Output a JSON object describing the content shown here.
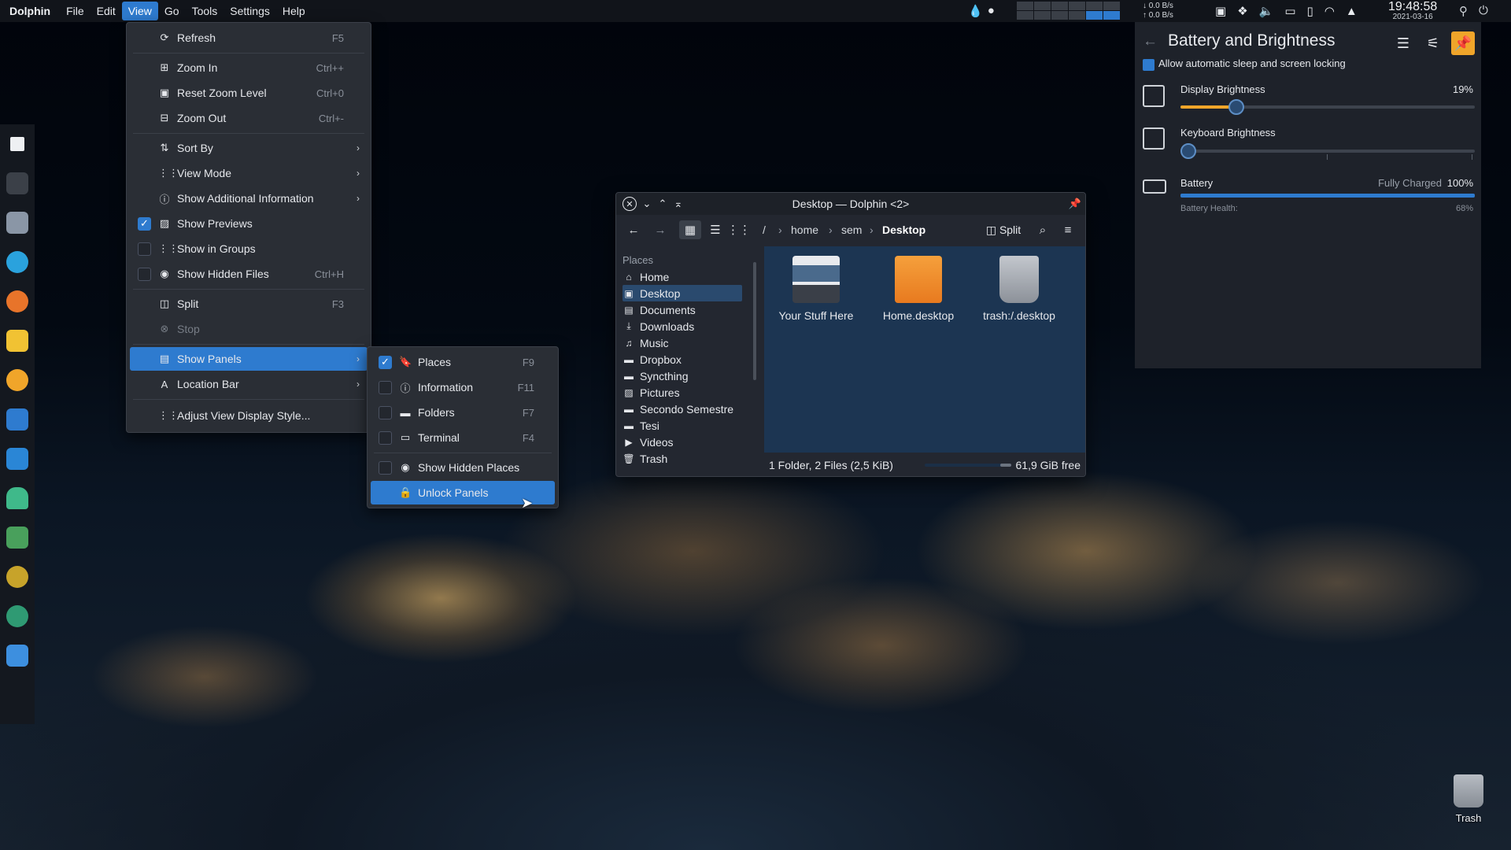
{
  "topbar": {
    "app_name": "Dolphin",
    "menus": [
      "File",
      "Edit",
      "View",
      "Go",
      "Tools",
      "Settings",
      "Help"
    ],
    "net_down": "0.0 B/s",
    "net_up": "0.0 B/s",
    "time": "19:48:58",
    "date": "2021-03-16"
  },
  "view_menu": {
    "items": [
      {
        "label": "Refresh",
        "shortcut": "F5",
        "icon": "⟳"
      },
      {
        "label": "Zoom In",
        "shortcut": "Ctrl++",
        "icon": "⊞"
      },
      {
        "label": "Reset Zoom Level",
        "shortcut": "Ctrl+0",
        "icon": "▣"
      },
      {
        "label": "Zoom Out",
        "shortcut": "Ctrl+-",
        "icon": "⊟"
      },
      {
        "label": "Sort By",
        "icon": "⇅"
      },
      {
        "label": "View Mode",
        "icon": "⋮⋮"
      },
      {
        "label": "Show Additional Information",
        "icon": "ⓘ"
      },
      {
        "label": "Show Previews",
        "icon": "▨"
      },
      {
        "label": "Show in Groups",
        "icon": "⋮⋮"
      },
      {
        "label": "Show Hidden Files",
        "shortcut": "Ctrl+H",
        "icon": "◉"
      },
      {
        "label": "Split",
        "shortcut": "F3",
        "icon": "◫"
      },
      {
        "label": "Stop",
        "icon": "⊗"
      },
      {
        "label": "Show Panels",
        "icon": "▤"
      },
      {
        "label": "Location Bar",
        "icon": "A"
      },
      {
        "label": "Adjust View Display Style...",
        "icon": "⋮⋮"
      }
    ]
  },
  "panels_submenu": {
    "items": [
      {
        "label": "Places",
        "shortcut": "F9",
        "icon": "🔖"
      },
      {
        "label": "Information",
        "shortcut": "F11",
        "icon": "ⓘ"
      },
      {
        "label": "Folders",
        "shortcut": "F7",
        "icon": "▬"
      },
      {
        "label": "Terminal",
        "shortcut": "F4",
        "icon": "▭"
      },
      {
        "label": "Show Hidden Places",
        "icon": "◉"
      },
      {
        "label": "Unlock Panels",
        "icon": "🔒"
      }
    ]
  },
  "dolphin": {
    "title": "Desktop — Dolphin <2>",
    "split_label": "Split",
    "breadcrumb": [
      "/",
      "home",
      "sem",
      "Desktop"
    ],
    "places_header": "Places",
    "places": [
      "Home",
      "Desktop",
      "Documents",
      "Downloads",
      "Music",
      "Dropbox",
      "Syncthing",
      "Pictures",
      "Secondo Semestre",
      "Tesi",
      "Videos",
      "Trash"
    ],
    "files": [
      "Your Stuff Here",
      "Home.desktop",
      "trash:/.desktop"
    ],
    "status": "1 Folder, 2 Files (2,5 KiB)",
    "free_space": "61,9 GiB free"
  },
  "battery_panel": {
    "title": "Battery and Brightness",
    "allow_sleep_label": "Allow automatic sleep and screen locking",
    "display_brightness_label": "Display Brightness",
    "display_brightness_value": "19%",
    "display_brightness_level": 0.19,
    "keyboard_brightness_label": "Keyboard Brightness",
    "keyboard_brightness_level": 0,
    "battery_label": "Battery",
    "battery_status": "Fully Charged",
    "battery_percent": "100%",
    "battery_level": 1.0,
    "battery_health_label": "Battery Health:",
    "battery_health_value": "68%"
  },
  "desktop": {
    "trash_label": "Trash"
  },
  "colors": {
    "accent": "#2e7bcf",
    "highlight_orange": "#f0a52a",
    "panel_bg": "#2a2e35"
  }
}
